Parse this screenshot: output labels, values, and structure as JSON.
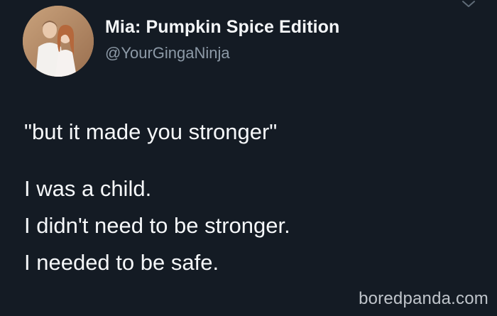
{
  "tweet": {
    "display_name": "Mia: Pumpkin Spice Edition",
    "handle": "@YourGingaNinja",
    "quote": "\"but it made you stronger\"",
    "lines": [
      "I was a child.",
      "I didn't need to be stronger.",
      "I needed to be safe."
    ]
  },
  "watermark": "boredpanda.com",
  "colors": {
    "background": "#141b24",
    "text": "#f5f7f9",
    "handle": "#8d9aa7"
  },
  "icons": {
    "menu": "chevron-down-icon",
    "avatar": "profile-photo"
  }
}
